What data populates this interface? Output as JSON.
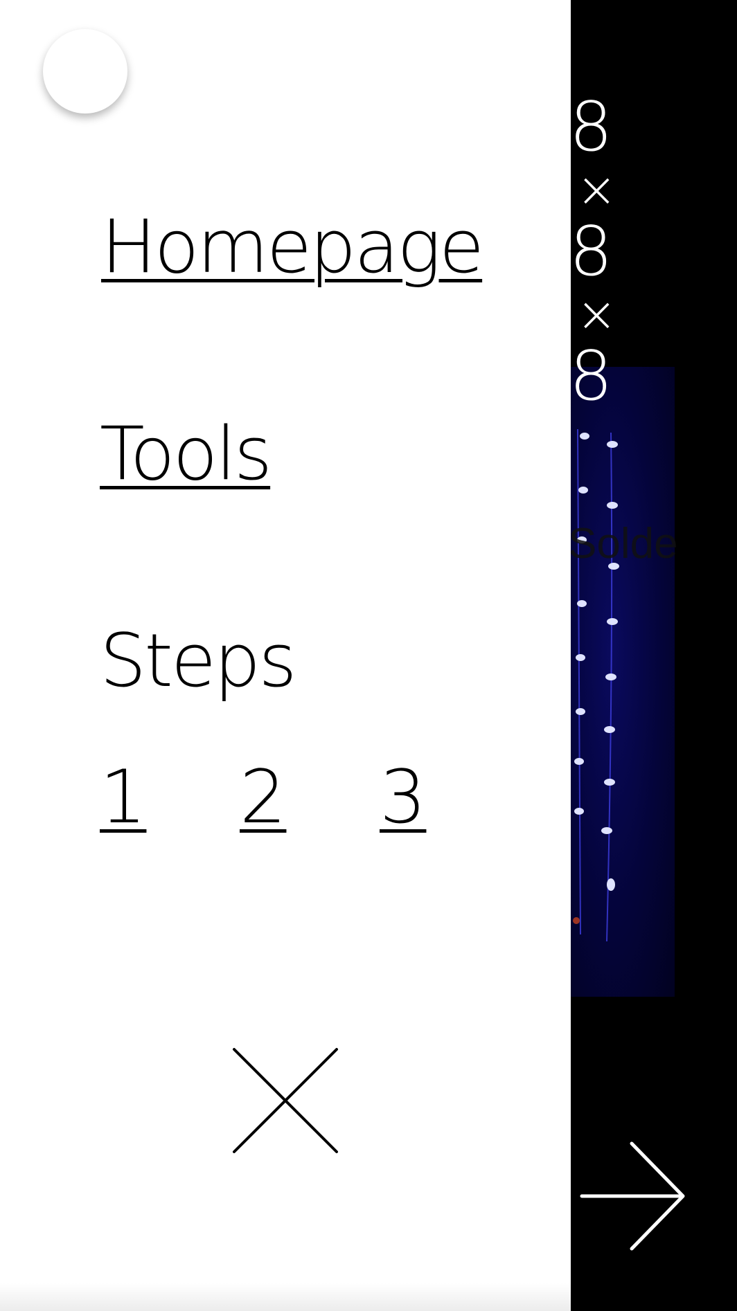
{
  "background": {
    "title_lines": [
      "8",
      "×",
      "8",
      "×",
      "8"
    ],
    "subtitle_fragment": "Solde"
  },
  "drawer": {
    "nav": {
      "homepage_label": "Homepage",
      "tools_label": "Tools"
    },
    "steps": {
      "heading": "Steps",
      "items": [
        "1",
        "2",
        "3"
      ]
    }
  },
  "icons": {
    "close": "close-icon",
    "next": "arrow-right-icon",
    "logo": "logo-circle"
  },
  "colors": {
    "drawer_bg": "#ffffff",
    "page_bg": "#000000",
    "text": "#000000",
    "led_blue": "#3a3aff"
  }
}
